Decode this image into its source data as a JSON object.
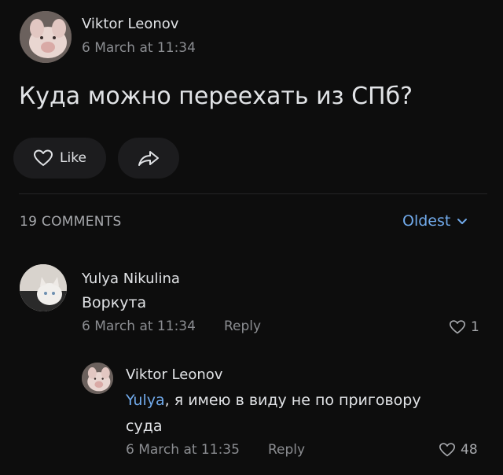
{
  "post": {
    "author": "Viktor Leonov",
    "date": "6 March at 11:34",
    "text": "Куда можно переехать из СПб?",
    "like_label": "Like"
  },
  "comments_header": {
    "count_label": "19 COMMENTS",
    "sort_label": "Oldest"
  },
  "comments": [
    {
      "author": "Yulya Nikulina",
      "text": "Воркута",
      "date": "6 March at 11:34",
      "reply_label": "Reply",
      "likes": "1"
    },
    {
      "author": "Viktor Leonov",
      "mention": "Yulya",
      "text_line1": ", я имею в виду не по приговору",
      "text_line2": "суда",
      "date": "6 March at 11:35",
      "reply_label": "Reply",
      "likes": "48"
    }
  ],
  "colors": {
    "background": "#0d0d0d",
    "accent": "#71aaeb",
    "secondary_text": "#8b8d91"
  }
}
